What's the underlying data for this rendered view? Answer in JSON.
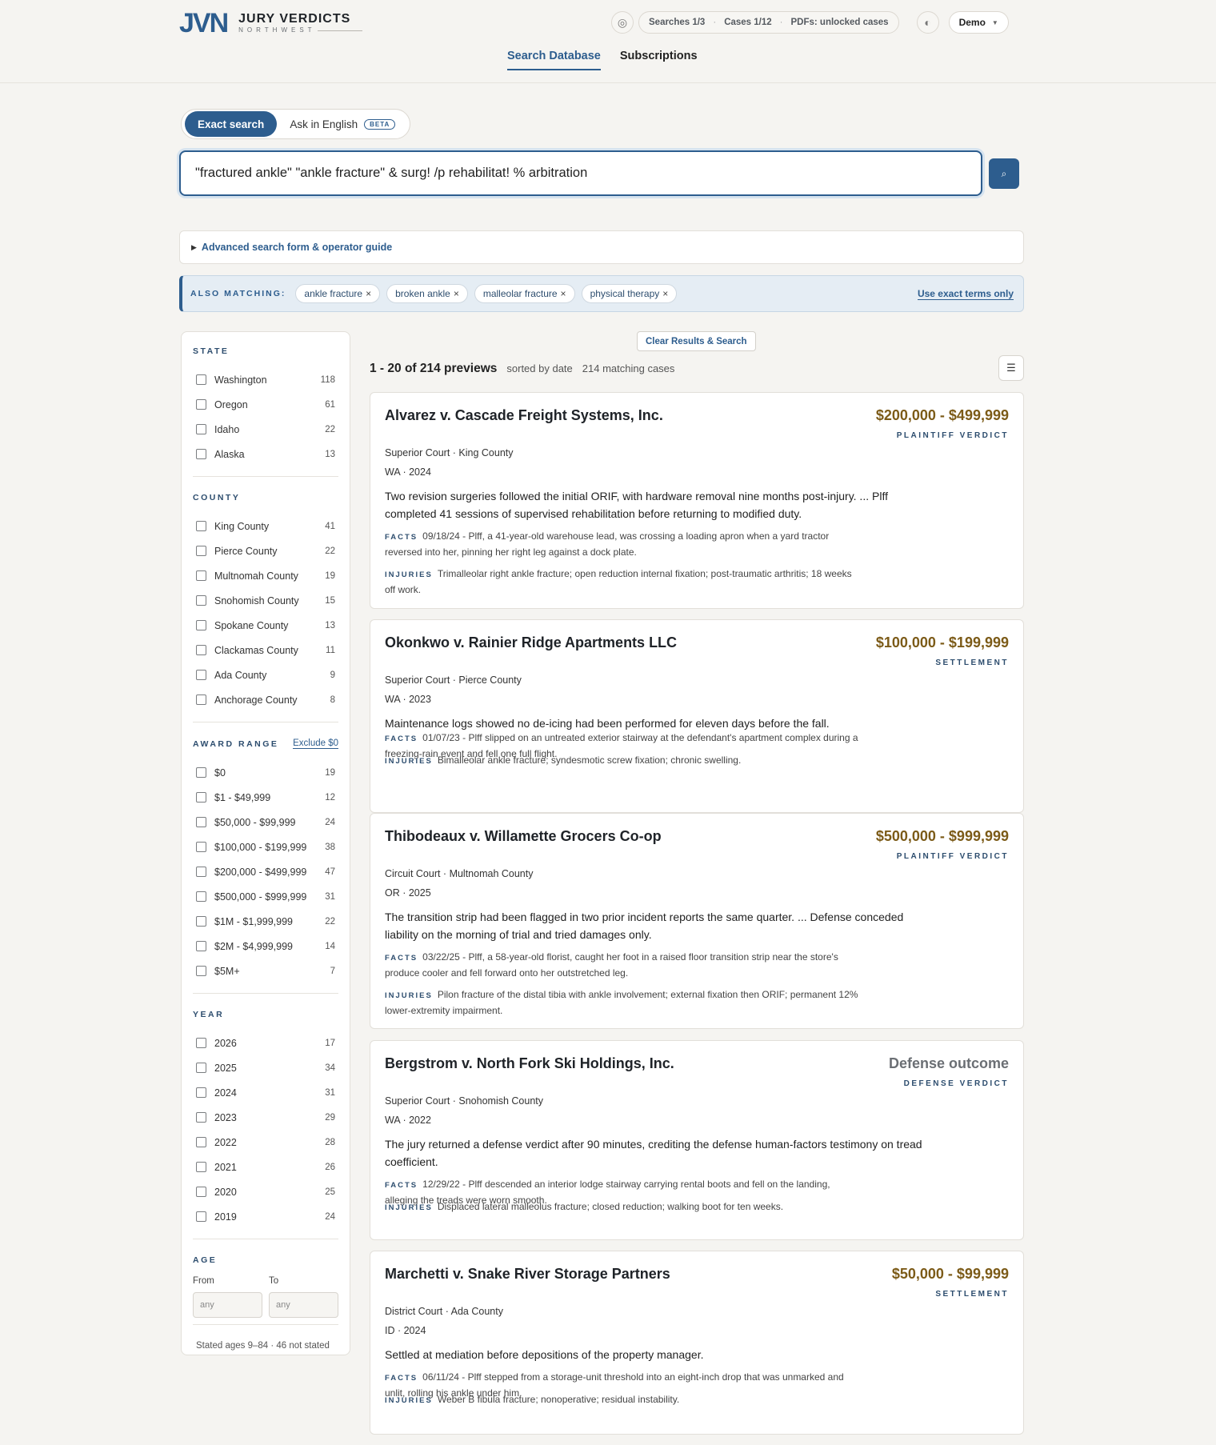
{
  "brand": {
    "mark": "JVN",
    "name": "JURY VERDICTS",
    "sub": "NORTHWEST"
  },
  "header": {
    "help_icon": "info-ring-icon",
    "searches": "Searches 1/3",
    "cases": "Cases 1/12",
    "pdfs": "PDFs: unlocked cases",
    "theme_icon": "half-circle-icon",
    "user": "Demo"
  },
  "nav": {
    "tabs": [
      {
        "label": "Search Database",
        "active": true
      },
      {
        "label": "Subscriptions",
        "active": false
      }
    ]
  },
  "search": {
    "mode_exact": "Exact search",
    "mode_english": "Ask in English",
    "beta": "BETA",
    "query": "\"fractured ankle\" \"ankle fracture\" & surg! /p rehabilitat! % arbitration",
    "button_icon": "search-icon"
  },
  "advanced": {
    "label": "Advanced search form & operator guide"
  },
  "also": {
    "label": "ALSO MATCHING:",
    "chips": [
      "ankle fracture",
      "broken ankle",
      "malleolar fracture",
      "physical therapy"
    ],
    "exact_link": "Use exact terms only"
  },
  "filters": {
    "state": {
      "title": "STATE",
      "items": [
        {
          "label": "Washington",
          "count": "118"
        },
        {
          "label": "Oregon",
          "count": "61"
        },
        {
          "label": "Idaho",
          "count": "22"
        },
        {
          "label": "Alaska",
          "count": "13"
        }
      ]
    },
    "county": {
      "title": "COUNTY",
      "items": [
        {
          "label": "King County",
          "count": "41"
        },
        {
          "label": "Pierce County",
          "count": "22"
        },
        {
          "label": "Multnomah County",
          "count": "19"
        },
        {
          "label": "Snohomish County",
          "count": "15"
        },
        {
          "label": "Spokane County",
          "count": "13"
        },
        {
          "label": "Clackamas County",
          "count": "11"
        },
        {
          "label": "Ada County",
          "count": "9"
        },
        {
          "label": "Anchorage County",
          "count": "8"
        }
      ]
    },
    "award": {
      "title": "AWARD RANGE",
      "exclude": "Exclude $0",
      "items": [
        {
          "label": "$0",
          "count": "19"
        },
        {
          "label": "$1 - $49,999",
          "count": "12"
        },
        {
          "label": "$50,000 - $99,999",
          "count": "24"
        },
        {
          "label": "$100,000 - $199,999",
          "count": "38"
        },
        {
          "label": "$200,000 - $499,999",
          "count": "47"
        },
        {
          "label": "$500,000 - $999,999",
          "count": "31"
        },
        {
          "label": "$1M - $1,999,999",
          "count": "22"
        },
        {
          "label": "$2M - $4,999,999",
          "count": "14"
        },
        {
          "label": "$5M+",
          "count": "7"
        }
      ]
    },
    "year": {
      "title": "YEAR",
      "items": [
        {
          "label": "2026",
          "count": "17"
        },
        {
          "label": "2025",
          "count": "34"
        },
        {
          "label": "2024",
          "count": "31"
        },
        {
          "label": "2023",
          "count": "29"
        },
        {
          "label": "2022",
          "count": "28"
        },
        {
          "label": "2021",
          "count": "26"
        },
        {
          "label": "2020",
          "count": "25"
        },
        {
          "label": "2019",
          "count": "24"
        }
      ]
    },
    "age": {
      "title": "AGE",
      "from": "From",
      "to": "To",
      "from_placeholder": "any",
      "to_placeholder": "any",
      "note": "Stated ages 9–84 · 46 not stated"
    }
  },
  "results": {
    "clear": "Clear Results & Search",
    "range": "1 - 20 of 214 previews",
    "sorted": "sorted by date",
    "matching": "214 matching cases",
    "sort_icon": "sort-icon",
    "cases": [
      {
        "title": "Alvarez v. Cascade Freight Systems, Inc.",
        "amount": "$200,000 - $499,999",
        "verdict": "PLAINTIFF VERDICT",
        "court": "Superior Court · King County",
        "state_year": "WA · 2024",
        "summary": "Two revision surgeries followed the initial ORIF, with hardware removal nine months post-injury. ... Plff completed 41 sessions of supervised rehabilitation before returning to modified duty.",
        "facts_label": "FACTS",
        "facts": "09/18/24 - Plff, a 41-year-old warehouse lead, was crossing a loading apron when a yard tractor reversed into her, pinning her right leg against a dock plate.",
        "injuries_label": "INJURIES",
        "injuries": "Trimalleolar right ankle fracture; open reduction internal fixation; post-traumatic arthritis; 18 weeks off work."
      },
      {
        "title": "Okonkwo v. Rainier Ridge Apartments LLC",
        "amount": "$100,000 - $199,999",
        "verdict": "SETTLEMENT",
        "court": "Superior Court · Pierce County",
        "state_year": "WA · 2023",
        "summary": "Maintenance logs showed no de-icing had been performed for eleven days before the fall.",
        "facts_label": "FACTS",
        "facts": "01/07/23 - Plff slipped on an untreated exterior stairway at the defendant's apartment complex during a freezing-rain event and fell one full flight.",
        "injuries_label": "INJURIES",
        "injuries": "Bimalleolar ankle fracture; syndesmotic screw fixation; chronic swelling."
      },
      {
        "title": "Thibodeaux v. Willamette Grocers Co-op",
        "amount": "$500,000 - $999,999",
        "verdict": "PLAINTIFF VERDICT",
        "court": "Circuit Court · Multnomah County",
        "state_year": "OR · 2025",
        "summary": "The transition strip had been flagged in two prior incident reports the same quarter. ... Defense conceded liability on the morning of trial and tried damages only.",
        "facts_label": "FACTS",
        "facts": "03/22/25 - Plff, a 58-year-old florist, caught her foot in a raised floor transition strip near the store's produce cooler and fell forward onto her outstretched leg.",
        "injuries_label": "INJURIES",
        "injuries": "Pilon fracture of the distal tibia with ankle involvement; external fixation then ORIF; permanent 12% lower-extremity impairment."
      },
      {
        "title": "Bergstrom v. North Fork Ski Holdings, Inc.",
        "amount": "Defense outcome",
        "verdict": "DEFENSE VERDICT",
        "court": "Superior Court · Snohomish County",
        "state_year": "WA · 2022",
        "summary": "The jury returned a defense verdict after 90 minutes, crediting the defense human-factors testimony on tread coefficient.",
        "facts_label": "FACTS",
        "facts": "12/29/22 - Plff descended an interior lodge stairway carrying rental boots and fell on the landing, alleging the treads were worn smooth.",
        "injuries_label": "INJURIES",
        "injuries": "Displaced lateral malleolus fracture; closed reduction; walking boot for ten weeks."
      },
      {
        "title": "Marchetti v. Snake River Storage Partners",
        "amount": "$50,000 - $99,999",
        "verdict": "SETTLEMENT",
        "court": "District Court · Ada County",
        "state_year": "ID · 2024",
        "summary": "Settled at mediation before depositions of the property manager.",
        "facts_label": "FACTS",
        "facts": "06/11/24 - Plff stepped from a storage-unit threshold into an eight-inch drop that was unmarked and unlit, rolling his ankle under him.",
        "injuries_label": "INJURIES",
        "injuries": "Weber B fibula fracture; nonoperative; residual instability."
      }
    ]
  }
}
